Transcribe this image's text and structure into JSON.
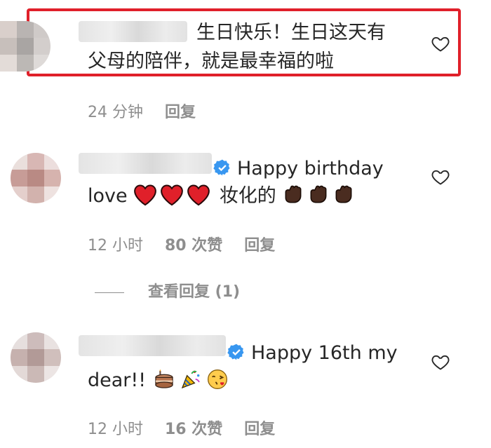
{
  "comments": [
    {
      "text_line1": "生日快乐！生日这天有",
      "text_line2": "父母的陪伴，就是最幸福的啦",
      "time": "24 分钟",
      "reply_label": "回复"
    },
    {
      "text_line1": "Happy birthday",
      "text_line2_prefix": "love",
      "text_line2_mid": "妆化的",
      "emoji_line2": [
        "red-heart",
        "red-heart",
        "red-heart",
        "raised-back-of-hand-dark",
        "raised-back-of-hand-dark",
        "raised-back-of-hand-dark"
      ],
      "time": "12 小时",
      "likes": "80 次赞",
      "reply_label": "回复",
      "view_replies": "查看回复 (1)"
    },
    {
      "text_line1": "Happy 16th my",
      "text_line2_prefix": "dear!!",
      "emoji_line2": [
        "birthday-cake",
        "party-popper",
        "face-blowing-kiss"
      ],
      "time": "12 小时",
      "likes": "16 次赞",
      "reply_label": "回复"
    }
  ],
  "colors": {
    "highlight_border": "#e0202a",
    "verified_badge": "#3897f0",
    "meta_text": "#8e8e8e",
    "heart_red": "#e0202a"
  }
}
